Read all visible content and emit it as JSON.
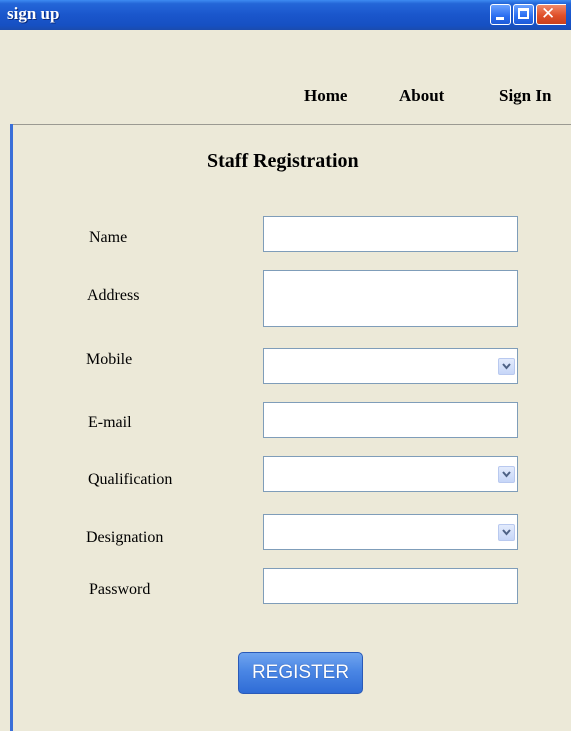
{
  "window": {
    "title": "sign up"
  },
  "nav": {
    "home": "Home",
    "about": "About",
    "sign_in": "Sign In"
  },
  "form": {
    "title": "Staff Registration",
    "fields": {
      "name": {
        "label": "Name",
        "value": ""
      },
      "address": {
        "label": "Address",
        "value": ""
      },
      "mobile": {
        "label": "Mobile",
        "value": ""
      },
      "email": {
        "label": "E-mail",
        "value": ""
      },
      "qualification": {
        "label": "Qualification",
        "value": ""
      },
      "designation": {
        "label": "Designation",
        "value": ""
      },
      "password": {
        "label": "Password",
        "value": ""
      }
    },
    "register_label": "REGISTER"
  },
  "colors": {
    "titlebar": "#1a56cc",
    "background": "#ece9d8",
    "field_border": "#7f9db9",
    "button": "#4a86e4"
  },
  "icons": {
    "minimize": "minimize-icon",
    "maximize": "maximize-icon",
    "close": "close-icon",
    "dropdown": "chevron-down-icon"
  }
}
